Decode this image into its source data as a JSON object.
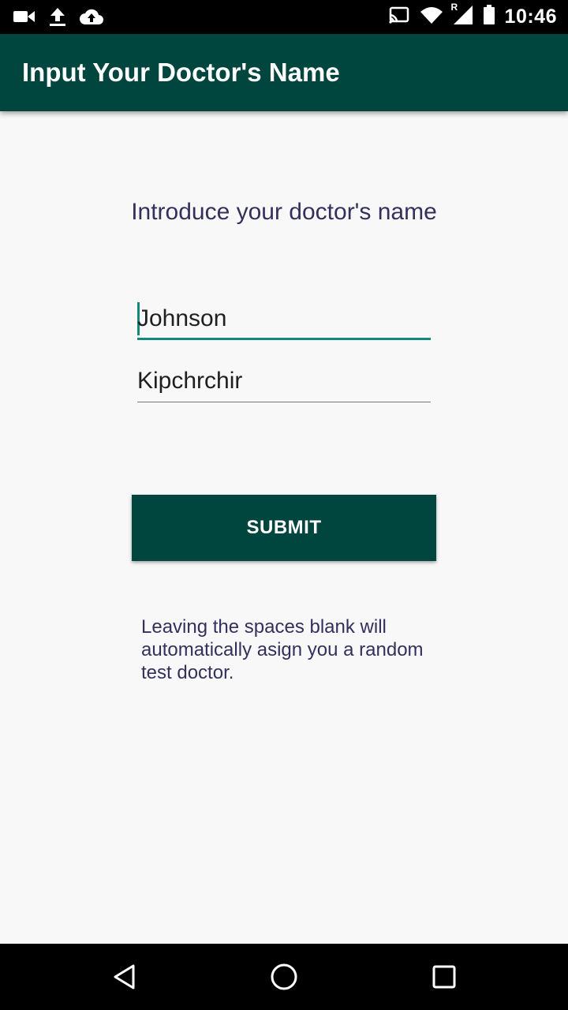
{
  "status_bar": {
    "time": "10:46",
    "icons_left": [
      "video-camera-icon",
      "upload-icon",
      "cloud-upload-icon"
    ],
    "icons_right": [
      "cast-icon",
      "wifi-icon",
      "signal-icon",
      "battery-icon"
    ],
    "signal_badge": "R"
  },
  "app_bar": {
    "title": "Input Your Doctor's Name",
    "color": "#00463e"
  },
  "form": {
    "prompt": "Introduce your doctor's name",
    "first_name": "Johnson",
    "last_name": "Kipchrchir",
    "submit_label": "SUBMIT",
    "hint": "Leaving the spaces blank will automatically asign you a random test doctor."
  },
  "nav_bar": {
    "icons": [
      "back-icon",
      "home-icon",
      "recents-icon"
    ]
  },
  "colors": {
    "accent": "#12897b",
    "text_primary": "#34305e"
  }
}
